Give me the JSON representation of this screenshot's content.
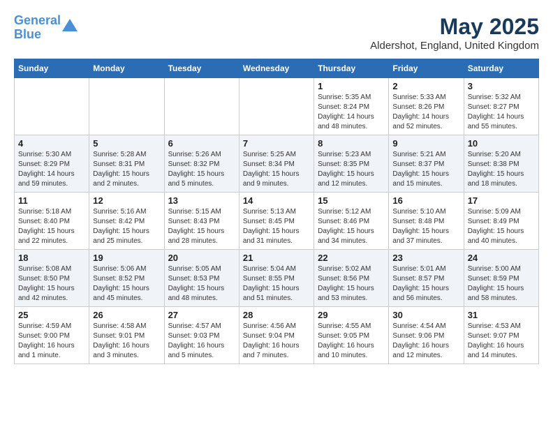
{
  "header": {
    "logo_line1": "General",
    "logo_line2": "Blue",
    "month": "May 2025",
    "location": "Aldershot, England, United Kingdom"
  },
  "weekdays": [
    "Sunday",
    "Monday",
    "Tuesday",
    "Wednesday",
    "Thursday",
    "Friday",
    "Saturday"
  ],
  "weeks": [
    [
      {
        "day": "",
        "info": ""
      },
      {
        "day": "",
        "info": ""
      },
      {
        "day": "",
        "info": ""
      },
      {
        "day": "",
        "info": ""
      },
      {
        "day": "1",
        "info": "Sunrise: 5:35 AM\nSunset: 8:24 PM\nDaylight: 14 hours\nand 48 minutes."
      },
      {
        "day": "2",
        "info": "Sunrise: 5:33 AM\nSunset: 8:26 PM\nDaylight: 14 hours\nand 52 minutes."
      },
      {
        "day": "3",
        "info": "Sunrise: 5:32 AM\nSunset: 8:27 PM\nDaylight: 14 hours\nand 55 minutes."
      }
    ],
    [
      {
        "day": "4",
        "info": "Sunrise: 5:30 AM\nSunset: 8:29 PM\nDaylight: 14 hours\nand 59 minutes."
      },
      {
        "day": "5",
        "info": "Sunrise: 5:28 AM\nSunset: 8:31 PM\nDaylight: 15 hours\nand 2 minutes."
      },
      {
        "day": "6",
        "info": "Sunrise: 5:26 AM\nSunset: 8:32 PM\nDaylight: 15 hours\nand 5 minutes."
      },
      {
        "day": "7",
        "info": "Sunrise: 5:25 AM\nSunset: 8:34 PM\nDaylight: 15 hours\nand 9 minutes."
      },
      {
        "day": "8",
        "info": "Sunrise: 5:23 AM\nSunset: 8:35 PM\nDaylight: 15 hours\nand 12 minutes."
      },
      {
        "day": "9",
        "info": "Sunrise: 5:21 AM\nSunset: 8:37 PM\nDaylight: 15 hours\nand 15 minutes."
      },
      {
        "day": "10",
        "info": "Sunrise: 5:20 AM\nSunset: 8:38 PM\nDaylight: 15 hours\nand 18 minutes."
      }
    ],
    [
      {
        "day": "11",
        "info": "Sunrise: 5:18 AM\nSunset: 8:40 PM\nDaylight: 15 hours\nand 22 minutes."
      },
      {
        "day": "12",
        "info": "Sunrise: 5:16 AM\nSunset: 8:42 PM\nDaylight: 15 hours\nand 25 minutes."
      },
      {
        "day": "13",
        "info": "Sunrise: 5:15 AM\nSunset: 8:43 PM\nDaylight: 15 hours\nand 28 minutes."
      },
      {
        "day": "14",
        "info": "Sunrise: 5:13 AM\nSunset: 8:45 PM\nDaylight: 15 hours\nand 31 minutes."
      },
      {
        "day": "15",
        "info": "Sunrise: 5:12 AM\nSunset: 8:46 PM\nDaylight: 15 hours\nand 34 minutes."
      },
      {
        "day": "16",
        "info": "Sunrise: 5:10 AM\nSunset: 8:48 PM\nDaylight: 15 hours\nand 37 minutes."
      },
      {
        "day": "17",
        "info": "Sunrise: 5:09 AM\nSunset: 8:49 PM\nDaylight: 15 hours\nand 40 minutes."
      }
    ],
    [
      {
        "day": "18",
        "info": "Sunrise: 5:08 AM\nSunset: 8:50 PM\nDaylight: 15 hours\nand 42 minutes."
      },
      {
        "day": "19",
        "info": "Sunrise: 5:06 AM\nSunset: 8:52 PM\nDaylight: 15 hours\nand 45 minutes."
      },
      {
        "day": "20",
        "info": "Sunrise: 5:05 AM\nSunset: 8:53 PM\nDaylight: 15 hours\nand 48 minutes."
      },
      {
        "day": "21",
        "info": "Sunrise: 5:04 AM\nSunset: 8:55 PM\nDaylight: 15 hours\nand 51 minutes."
      },
      {
        "day": "22",
        "info": "Sunrise: 5:02 AM\nSunset: 8:56 PM\nDaylight: 15 hours\nand 53 minutes."
      },
      {
        "day": "23",
        "info": "Sunrise: 5:01 AM\nSunset: 8:57 PM\nDaylight: 15 hours\nand 56 minutes."
      },
      {
        "day": "24",
        "info": "Sunrise: 5:00 AM\nSunset: 8:59 PM\nDaylight: 15 hours\nand 58 minutes."
      }
    ],
    [
      {
        "day": "25",
        "info": "Sunrise: 4:59 AM\nSunset: 9:00 PM\nDaylight: 16 hours\nand 1 minute."
      },
      {
        "day": "26",
        "info": "Sunrise: 4:58 AM\nSunset: 9:01 PM\nDaylight: 16 hours\nand 3 minutes."
      },
      {
        "day": "27",
        "info": "Sunrise: 4:57 AM\nSunset: 9:03 PM\nDaylight: 16 hours\nand 5 minutes."
      },
      {
        "day": "28",
        "info": "Sunrise: 4:56 AM\nSunset: 9:04 PM\nDaylight: 16 hours\nand 7 minutes."
      },
      {
        "day": "29",
        "info": "Sunrise: 4:55 AM\nSunset: 9:05 PM\nDaylight: 16 hours\nand 10 minutes."
      },
      {
        "day": "30",
        "info": "Sunrise: 4:54 AM\nSunset: 9:06 PM\nDaylight: 16 hours\nand 12 minutes."
      },
      {
        "day": "31",
        "info": "Sunrise: 4:53 AM\nSunset: 9:07 PM\nDaylight: 16 hours\nand 14 minutes."
      }
    ]
  ]
}
